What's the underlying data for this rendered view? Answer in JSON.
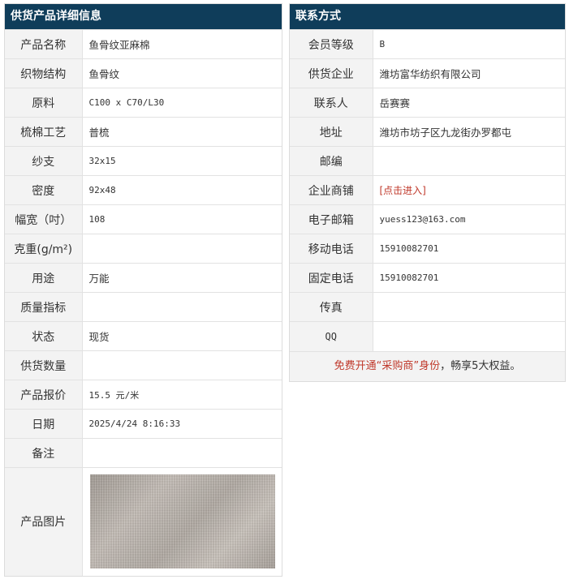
{
  "supply": {
    "title": "供货产品详细信息",
    "rows": [
      {
        "label": "产品名称",
        "value": "鱼骨纹亚麻棉"
      },
      {
        "label": "织物结构",
        "value": "鱼骨纹"
      },
      {
        "label": "原料",
        "value": "C100 x C70/L30"
      },
      {
        "label": "梳棉工艺",
        "value": "普梳"
      },
      {
        "label": "纱支",
        "value": "32x15"
      },
      {
        "label": "密度",
        "value": "92x48"
      },
      {
        "label": "幅宽（吋）",
        "value": "108"
      },
      {
        "label": "克重(g/m²)",
        "value": ""
      },
      {
        "label": "用途",
        "value": "万能"
      },
      {
        "label": "质量指标",
        "value": ""
      },
      {
        "label": "状态",
        "value": "现货"
      },
      {
        "label": "供货数量",
        "value": ""
      },
      {
        "label": "产品报价",
        "value": "15.5 元/米"
      },
      {
        "label": "日期",
        "value": "2025/4/24 8:16:33"
      },
      {
        "label": "备注",
        "value": ""
      },
      {
        "label": "产品图片",
        "value": ""
      }
    ]
  },
  "contact": {
    "title": "联系方式",
    "rows": [
      {
        "label": "会员等级",
        "value": "B"
      },
      {
        "label": "供货企业",
        "value": "潍坊富华纺织有限公司"
      },
      {
        "label": "联系人",
        "value": "岳赛赛"
      },
      {
        "label": "地址",
        "value": "潍坊市坊子区九龙街办罗都屯"
      },
      {
        "label": "邮编",
        "value": ""
      },
      {
        "label": "企业商铺",
        "value": "[点击进入]"
      },
      {
        "label": "电子邮箱",
        "value": "yuess123@163.com"
      },
      {
        "label": "移动电话",
        "value": "15910082701"
      },
      {
        "label": "固定电话",
        "value": "15910082701"
      },
      {
        "label": "传真",
        "value": ""
      },
      {
        "label": "QQ",
        "value": ""
      }
    ],
    "promo": {
      "part1": "免费开通“采购商”身份",
      "part2": "，畅享5大权益。"
    }
  },
  "colors": {
    "header_bg": "#0f3d5a",
    "label_bg": "#f3f3f3",
    "accent_red": "#c0392b"
  }
}
